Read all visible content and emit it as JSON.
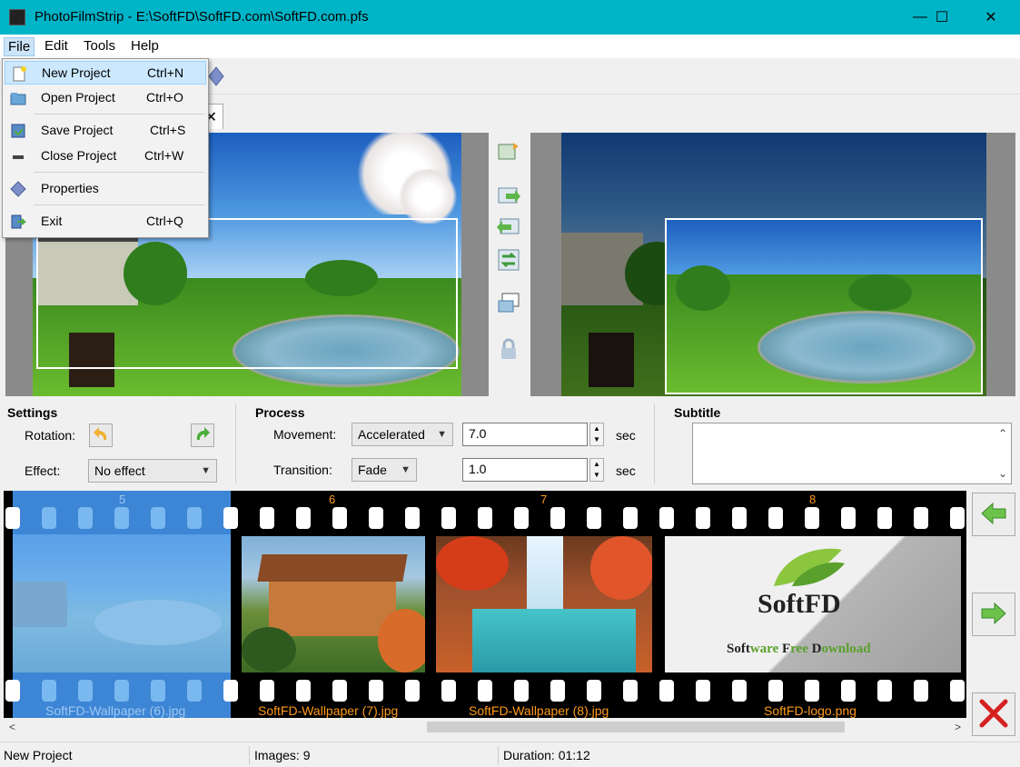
{
  "window": {
    "title": "PhotoFilmStrip - E:\\SoftFD\\SoftFD.com\\SoftFD.com.pfs",
    "minimize": "—",
    "maximize": "☐",
    "close": "✕",
    "accent_color": "#00b4c8"
  },
  "menubar": {
    "items": [
      "File",
      "Edit",
      "Tools",
      "Help"
    ]
  },
  "file_menu": {
    "items": [
      {
        "label": "New Project",
        "shortcut": "Ctrl+N",
        "icon": "new-project-icon"
      },
      {
        "label": "Open Project",
        "shortcut": "Ctrl+O",
        "icon": "open-folder-icon"
      },
      {
        "label": "Save Project",
        "shortcut": "Ctrl+S",
        "icon": "save-icon"
      },
      {
        "label": "Close Project",
        "shortcut": "Ctrl+W",
        "icon": "close-project-icon"
      },
      {
        "label": "Properties",
        "shortcut": "",
        "icon": "properties-icon"
      },
      {
        "label": "Exit",
        "shortcut": "Ctrl+Q",
        "icon": "exit-icon"
      }
    ]
  },
  "settings": {
    "heading": "Settings",
    "rotation_label": "Rotation:",
    "effect_label": "Effect:",
    "effect_value": "No effect"
  },
  "process": {
    "heading": "Process",
    "movement_label": "Movement:",
    "movement_value": "Accelerated",
    "movement_duration": "7.0",
    "transition_label": "Transition:",
    "transition_value": "Fade",
    "transition_duration": "1.0",
    "unit": "sec"
  },
  "subtitle": {
    "heading": "Subtitle",
    "value": ""
  },
  "filmstrip": {
    "frames": [
      {
        "number": "5",
        "name": "SoftFD-Wallpaper (6).jpg",
        "selected": true
      },
      {
        "number": "6",
        "name": "SoftFD-Wallpaper (7).jpg",
        "selected": false
      },
      {
        "number": "7",
        "name": "SoftFD-Wallpaper (8).jpg",
        "selected": false
      },
      {
        "number": "8",
        "name": "SoftFD-logo.png",
        "selected": false
      }
    ],
    "logo": {
      "brand": "SoftFD",
      "tagline_soft": "Soft",
      "tagline_ware": "ware ",
      "tagline_f": "F",
      "tagline_ree": "ree ",
      "tagline_d": "D",
      "tagline_ownload": "ownload"
    }
  },
  "statusbar": {
    "project": "New Project",
    "images": "Images: 9",
    "duration": "Duration: 01:12"
  }
}
